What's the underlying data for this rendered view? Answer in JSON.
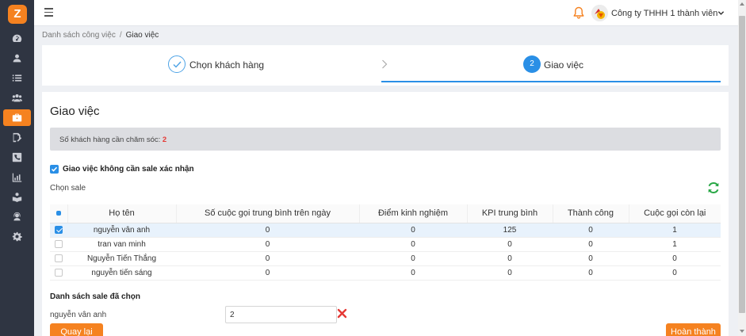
{
  "app": {
    "logo_letter": "Z"
  },
  "sidebar": {
    "items": [
      {
        "icon": "dashboard-icon",
        "active": false
      },
      {
        "icon": "user-icon",
        "active": false
      },
      {
        "icon": "list-icon",
        "active": false
      },
      {
        "icon": "users-icon",
        "active": false
      },
      {
        "icon": "briefcase-icon",
        "active": true
      },
      {
        "icon": "edit-document-icon",
        "active": false
      },
      {
        "icon": "phone-icon",
        "active": false
      },
      {
        "icon": "chart-icon",
        "active": false
      },
      {
        "icon": "book-icon",
        "active": false
      },
      {
        "icon": "support-icon",
        "active": false
      },
      {
        "icon": "gear-icon",
        "active": false
      }
    ]
  },
  "header": {
    "company": "Công ty THHH 1 thành viên"
  },
  "breadcrumb": {
    "parent": "Danh sách công việc",
    "separator": "/",
    "current": "Giao việc"
  },
  "steps": [
    {
      "number": "",
      "label": "Chọn khách hàng",
      "state": "done"
    },
    {
      "number": "2",
      "label": "Giao việc",
      "state": "active"
    }
  ],
  "main": {
    "title": "Giao việc",
    "info_label": "Số khách hàng cần chăm sóc: ",
    "info_count": "2",
    "confirm_label": "Giao việc không cần sale xác nhận",
    "confirm_checked": true,
    "choose_sale_label": "Chọn sale"
  },
  "table": {
    "headers": [
      "Họ tên",
      "Số cuộc gọi trung bình trên ngày",
      "Điểm kinh nghiệm",
      "KPI trung bình",
      "Thành công",
      "Cuộc gọi còn lại"
    ],
    "rows": [
      {
        "checked": true,
        "cells": [
          "nguyễn vân anh",
          "0",
          "0",
          "125",
          "0",
          "1"
        ]
      },
      {
        "checked": false,
        "cells": [
          "tran van minh",
          "0",
          "0",
          "0",
          "0",
          "1"
        ]
      },
      {
        "checked": false,
        "cells": [
          "Nguyễn Tiến Thắng",
          "0",
          "0",
          "0",
          "0",
          "0"
        ]
      },
      {
        "checked": false,
        "cells": [
          "nguyễn tiến sáng",
          "0",
          "0",
          "0",
          "0",
          "0"
        ]
      }
    ]
  },
  "selected": {
    "title": "Danh sách sale đã chọn",
    "items": [
      {
        "name": "nguyễn vân anh",
        "value": "2"
      }
    ]
  },
  "buttons": {
    "back": "Quay lại",
    "done": "Hoàn thành"
  },
  "colors": {
    "accent": "#f58220",
    "primary": "#2a8fe6",
    "sidebar": "#2f3542",
    "danger": "#e53935",
    "refresh": "#28a745"
  }
}
